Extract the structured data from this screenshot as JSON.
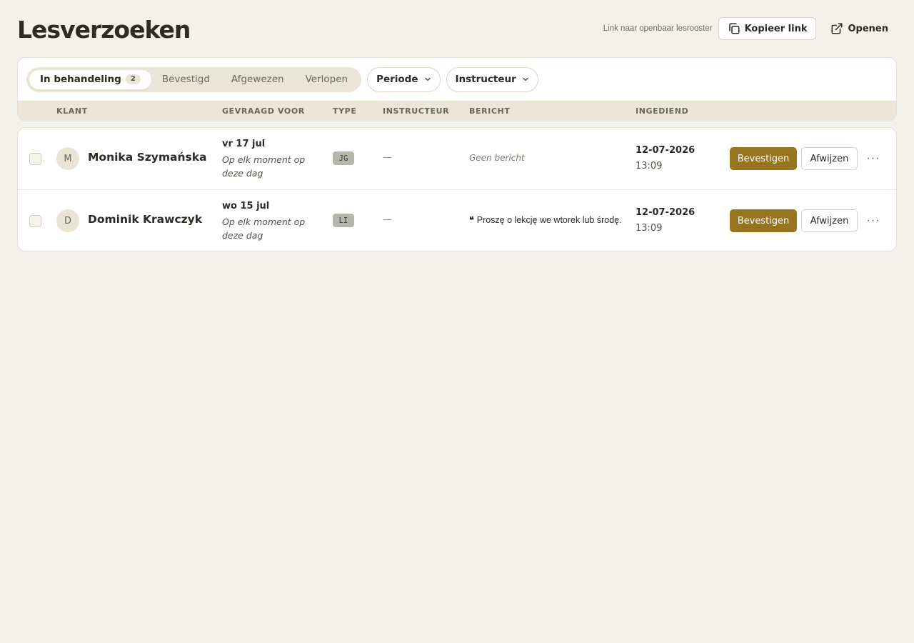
{
  "page": {
    "title": "Lesverzoeken"
  },
  "header": {
    "share_label": "Link naar openbaar lesrooster",
    "copy_label": "Kopieer link",
    "open_label": "Openen"
  },
  "filters": {
    "tabs": [
      {
        "label": "In behandeling",
        "count": "2",
        "active": true
      },
      {
        "label": "Bevestigd"
      },
      {
        "label": "Afgewezen"
      },
      {
        "label": "Verlopen"
      }
    ],
    "period_label": "Periode",
    "instructor_label": "Instructeur"
  },
  "table": {
    "headers": {
      "client": "KLANT",
      "requested_for": "GEVRAAGD VOOR",
      "type": "TYPE",
      "instructor": "INSTRUCTEUR",
      "message": "BERICHT",
      "submitted": "INGEDIEND"
    },
    "rows": [
      {
        "initial": "M",
        "name": "Monika Szymańska",
        "date": "vr 17 jul",
        "date_note": "Op elk moment op deze dag",
        "type": "JG",
        "instructor": "—",
        "message_empty": "Geen bericht",
        "submitted_date": "12-07-2026",
        "submitted_time": "13:09",
        "confirm_label": "Bevestigen",
        "reject_label": "Afwijzen",
        "more_label": "···"
      },
      {
        "initial": "D",
        "name": "Dominik Krawczyk",
        "date": "wo 15 jul",
        "date_note": "Op elk moment op deze dag",
        "type": "LI",
        "instructor": "—",
        "quote_mark": "❝",
        "message": "Proszę o lekcję we wtorek lub środę.",
        "submitted_date": "12-07-2026",
        "submitted_time": "13:09",
        "confirm_label": "Bevestigen",
        "reject_label": "Afwijzen",
        "more_label": "···"
      }
    ]
  },
  "colors": {
    "background": "#f4f1ea",
    "accent": "#977420",
    "header_band": "#ece5d8"
  }
}
